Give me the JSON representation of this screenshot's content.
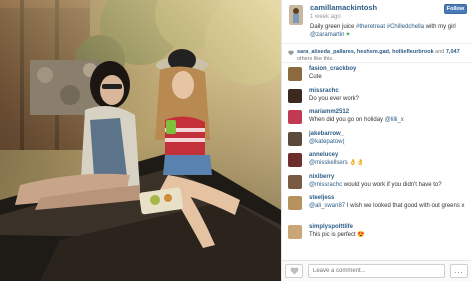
{
  "post": {
    "username": "camillamackintosh",
    "time_ago": "1 week ago",
    "caption_text": "Daily green juice ",
    "caption_tags": [
      "#theretreat",
      "#Chilledchella"
    ],
    "caption_mid": " with my girl ",
    "caption_mention": "@zaramartin",
    "follow_label": "Follow"
  },
  "likes": {
    "users": "sara_aliseda_pallares, heshsm.gad, holliefleurbrook",
    "connector": " and ",
    "count_label": "7,047",
    "suffix": " others like this."
  },
  "comments": [
    {
      "user": "fasion_crackboy",
      "text": "Cute",
      "mention": "",
      "avatar_color": "#8b6b3d"
    },
    {
      "user": "missrachc",
      "text": "Do you ever work?",
      "mention": "",
      "avatar_color": "#3b2a22"
    },
    {
      "user": "mariamm2512",
      "text": "When did you go on holiday ",
      "mention": "@lilli_x",
      "avatar_color": "#c23a52"
    },
    {
      "user": "jakebarrow_",
      "text": "",
      "mention": "@katepatow(",
      "avatar_color": "#5b4a3a"
    },
    {
      "user": "annelucey",
      "text": "",
      "mention": "@misskellsers 👌👌",
      "avatar_color": "#6e2e2e"
    },
    {
      "user": "nixiberry",
      "text": " would you work if you didn't have to?",
      "mention": "@missrachc",
      "avatar_color": "#7b5a44"
    },
    {
      "user": "steeljess",
      "text": " I wish we looked that good with out greens x",
      "mention": "@ali_swan87",
      "avatar_color": "#b6925f"
    },
    {
      "user": "simplyspolttlife",
      "text": "This pic is perfect 😍",
      "mention": "",
      "avatar_color": "#c9a678"
    }
  ],
  "footer": {
    "comment_placeholder": "Leave a comment...",
    "more_label": "..."
  },
  "colors": {
    "link_blue": "#2d5d86",
    "follow_button": "#4a7bb7"
  }
}
